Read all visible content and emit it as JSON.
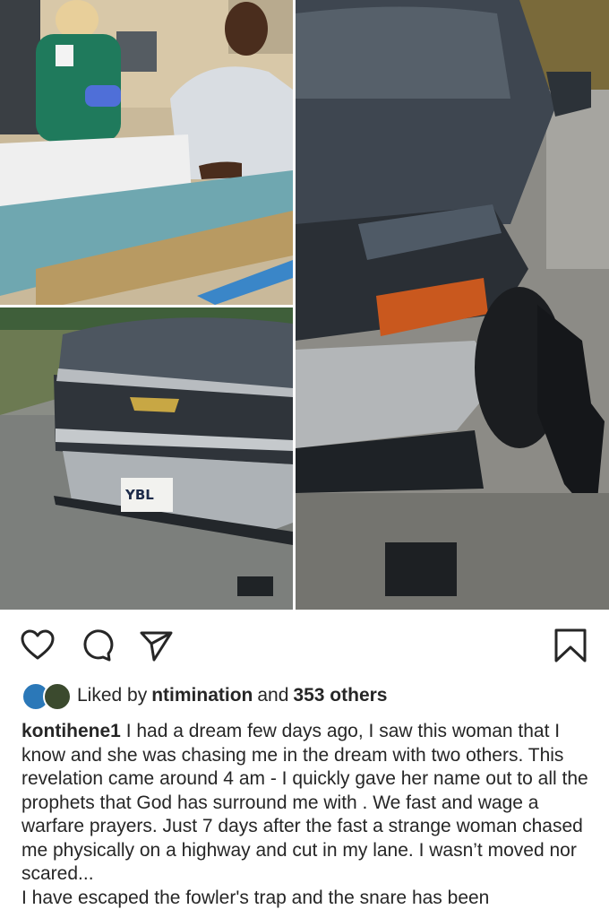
{
  "post": {
    "liked_by_prefix": "Liked by",
    "liked_by_user": "ntimination",
    "liked_by_and": "and",
    "liked_by_others": "353 others",
    "author": "kontihene1",
    "caption_first": "I had a dream few days ago, I saw this woman that I know and she was chasing me in the dream with two others. This revelation came around 4 am - I quickly gave her name out to all the prophets that God has surround me with . We fast and wage a warfare prayers.  Just 7 days after the fast a strange woman chased me physically on a highway and cut in my lane. I wasn’t moved nor scared...",
    "caption_second": "I have escaped the fowler's trap and the snare has been",
    "license_plate": "YBL"
  },
  "icons": {
    "like": "heart-icon",
    "comment": "comment-icon",
    "share": "paper-plane-icon",
    "save": "bookmark-icon"
  },
  "colors": {
    "text": "#262626",
    "background": "#ffffff"
  }
}
